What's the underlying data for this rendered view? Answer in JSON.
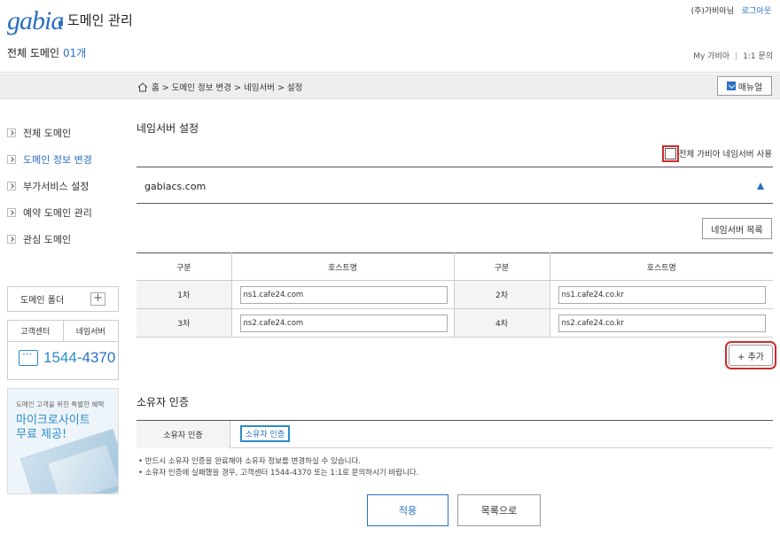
{
  "header": {
    "logo": "gabia",
    "title": "도메인 관리",
    "user": "(주)가비아님",
    "logout": "로그아웃",
    "total_label": "전체 도메인",
    "total_count": "01개",
    "my_gabia": "My 가비아",
    "sep": "|",
    "inquiry": "1:1 문의"
  },
  "breadcrumb": {
    "items": "홈 > 도메인 정보 변경 > 네임서버 > 설정",
    "manual": "매뉴얼"
  },
  "nav": {
    "items": [
      {
        "label": "전체 도메인"
      },
      {
        "label": "도메인 정보 변경"
      },
      {
        "label": "부가서비스 설정"
      },
      {
        "label": "예약 도메인 관리"
      },
      {
        "label": "관심 도메인"
      }
    ],
    "folder": "도메인 폴더",
    "plus": "+"
  },
  "support": {
    "tab1": "고객센터",
    "tab2": "네임서버",
    "phone_a": "1544-",
    "phone_b": "4370"
  },
  "promo": {
    "small": "도메인 고객을 위한 특별한 혜택",
    "line1": "마이크로사이트",
    "line2": "무료 제공!"
  },
  "nameserver": {
    "title": "네임서버 설정",
    "all_gabia": "전체 가비아 네임서버 사용",
    "domain": "gabiacs.com",
    "list_button": "네임서버 목록",
    "col_type": "구분",
    "col_host": "호스트명",
    "rows": [
      {
        "l1": "1차",
        "v1": "ns1.cafe24.com",
        "l2": "2차",
        "v2": "ns1.cafe24.co.kr"
      },
      {
        "l1": "3차",
        "v1": "ns2.cafe24.com",
        "l2": "4차",
        "v2": "ns2.cafe24.co.kr"
      }
    ],
    "add_button": "+ 추가"
  },
  "owner": {
    "title": "소유자 인증",
    "label": "소유자 인증",
    "button": "소유자 인증",
    "note1": "반드시 소유자 인증을 완료해야 소유자 정보를 변경하실 수 있습니다.",
    "note2": "소유자 인증에 실패했을 경우, 고객센터 1544-4370 또는 1:1로 문의하시기 바랍니다."
  },
  "actions": {
    "apply": "적용",
    "list": "목록으로"
  },
  "colors": {
    "brand": "#2b6fc1",
    "highlight": "#cc2b2b"
  }
}
